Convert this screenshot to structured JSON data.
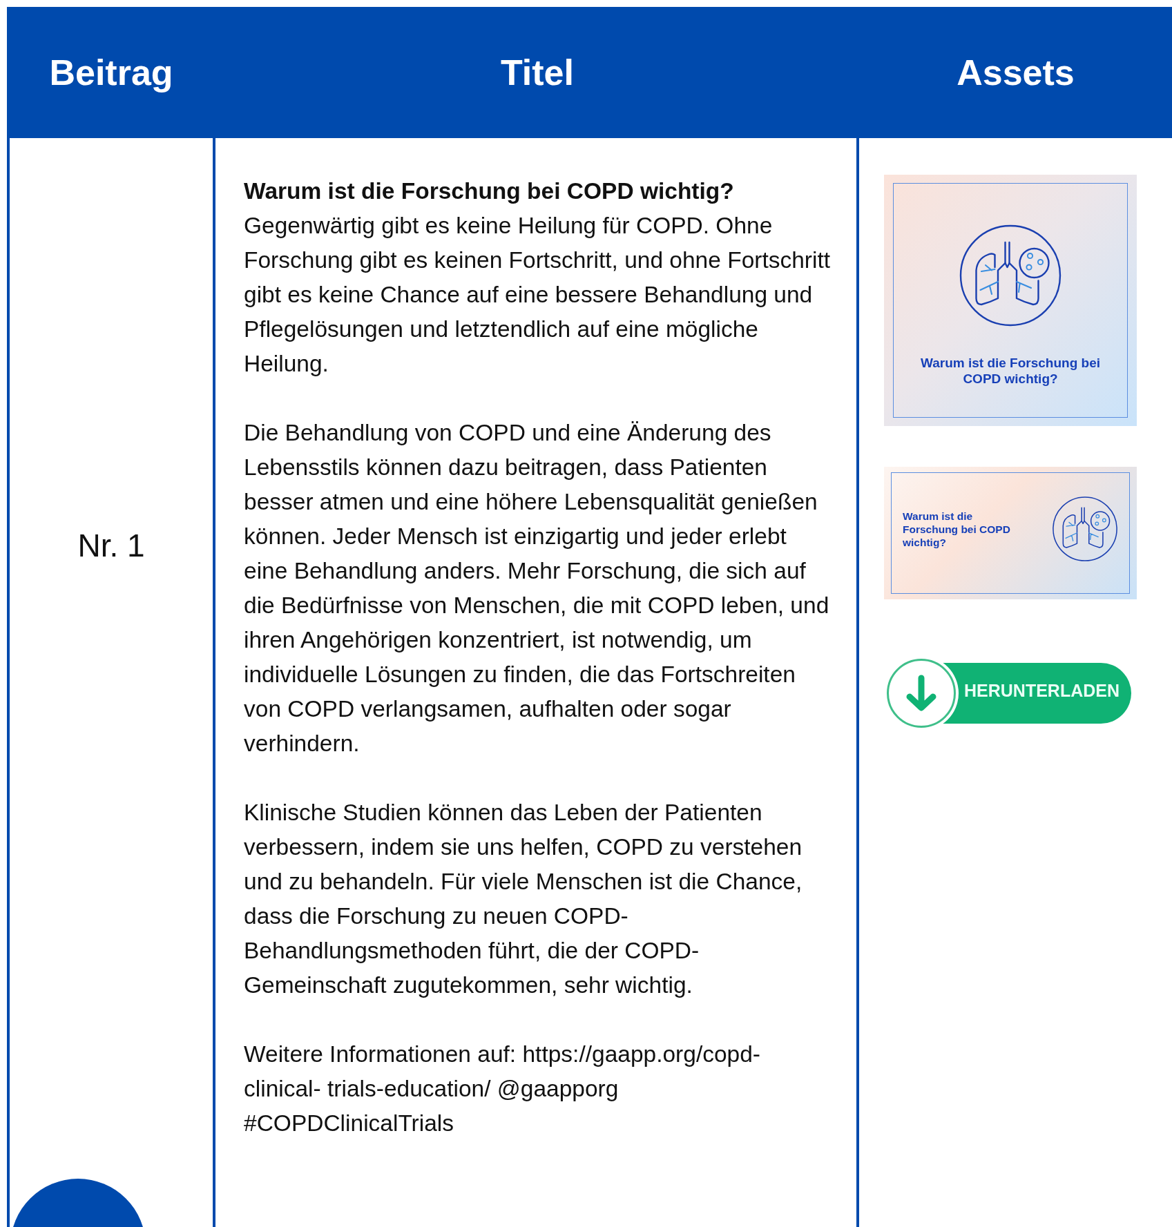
{
  "table": {
    "columns": [
      "Beitrag",
      "Titel",
      "Assets"
    ],
    "rows": [
      {
        "post": "Nr. 1",
        "heading": "Warum ist die Forschung bei COPD wichtig?",
        "paragraphs": [
          "Gegenwärtig gibt es keine Heilung für COPD. Ohne Forschung gibt es keinen Fortschritt, und ohne Fortschritt gibt es keine Chance auf eine bessere Behandlung und Pflegelösungen und letztendlich auf eine mögliche Heilung.",
          "Die Behandlung von COPD und eine Änderung des Lebensstils können dazu beitragen, dass Patienten besser atmen und eine höhere Lebensqualität genießen können. Jeder Mensch ist einzigartig und jeder erlebt eine Behandlung anders. Mehr Forschung, die sich auf die Bedürfnisse von Menschen, die mit COPD leben, und ihren Angehörigen konzentriert, ist notwendig, um individuelle Lösungen zu finden, die das Fortschreiten von COPD verlangsamen, aufhalten oder sogar verhindern.",
          "Klinische Studien können das Leben der Patienten verbessern, indem sie uns helfen, COPD zu verstehen und zu behandeln. Für viele Menschen ist die Chance, dass die Forschung zu neuen COPD-Behandlungsmethoden führt, die der COPD-Gemeinschaft zugutekommen, sehr wichtig.",
          "Weitere Informationen auf: https://gaapp.org/copd-clinical- trials-education/ @gaapporg #COPDClinicalTrials"
        ],
        "assets": [
          {
            "kind": "square",
            "caption": "Warum ist die Forschung bei COPD wichtig?"
          },
          {
            "kind": "banner",
            "caption": "Warum ist die Forschung bei COPD wichtig?"
          }
        ],
        "download_button": "HERUNTERLADEN"
      }
    ]
  }
}
